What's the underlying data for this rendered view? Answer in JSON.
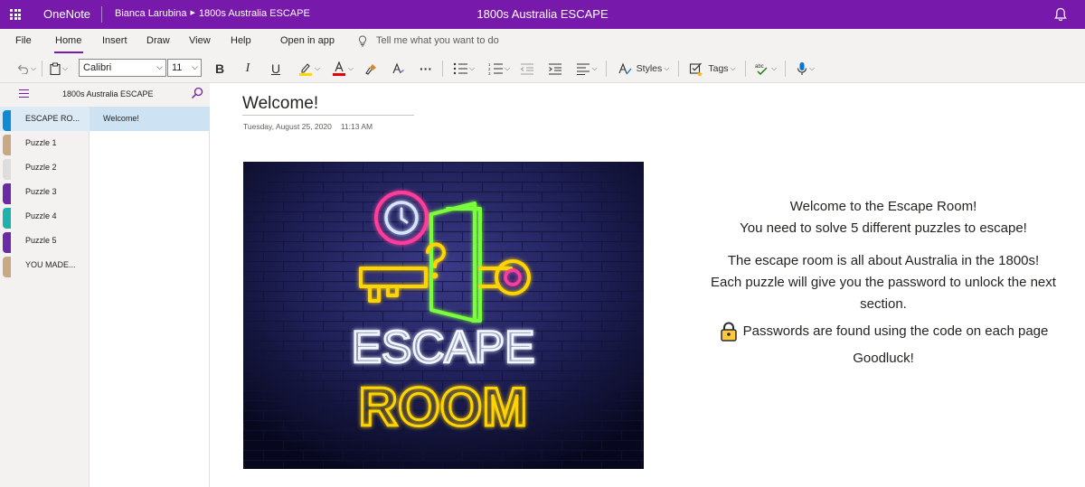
{
  "topbar": {
    "app_name": "OneNote",
    "breadcrumb_user": "Bianca Larubina",
    "breadcrumb_notebook": "1800s Australia ESCAPE",
    "doc_title": "1800s Australia ESCAPE",
    "accent_color": "#7719aa"
  },
  "menu": {
    "file": "File",
    "home": "Home",
    "insert": "Insert",
    "draw": "Draw",
    "view": "View",
    "help": "Help",
    "open_in_app": "Open in app",
    "tell_me": "Tell me what you want to do"
  },
  "toolbar": {
    "font_name": "Calibri",
    "font_size": "11",
    "bold": "B",
    "italic": "I",
    "underline": "U",
    "more": "···",
    "styles_label": "Styles",
    "tags_label": "Tags",
    "highlight_color": "#ffd800",
    "font_color": "#e3000b"
  },
  "notebook": {
    "name": "1800s Australia ESCAPE",
    "sections": [
      {
        "label": "ESCAPE RO...",
        "color": "#0d8ad1"
      },
      {
        "label": "Puzzle 1",
        "color": "#c9a985"
      },
      {
        "label": "Puzzle 2",
        "color": "#dddddd"
      },
      {
        "label": "Puzzle 3",
        "color": "#6a2ba5"
      },
      {
        "label": "Puzzle 4",
        "color": "#20b2aa"
      },
      {
        "label": "Puzzle 5",
        "color": "#6a2ba5"
      },
      {
        "label": "YOU MADE...",
        "color": "#c9a985"
      }
    ],
    "pages": [
      {
        "label": "Welcome!"
      }
    ]
  },
  "page": {
    "title": "Welcome!",
    "date": "Tuesday, August 25, 2020",
    "time": "11:13 AM",
    "image_text_top": "ESCAPE",
    "image_text_bottom": "ROOM",
    "body": {
      "line1": "Welcome to the Escape Room!",
      "line2": "You need to solve 5 different puzzles to escape!",
      "line3": "The escape room is all about Australia in the 1800s!",
      "line4": "Each puzzle will give you the password to unlock the next section.",
      "line5": "Passwords are found using the code on each page",
      "line6": "Goodluck!"
    }
  }
}
